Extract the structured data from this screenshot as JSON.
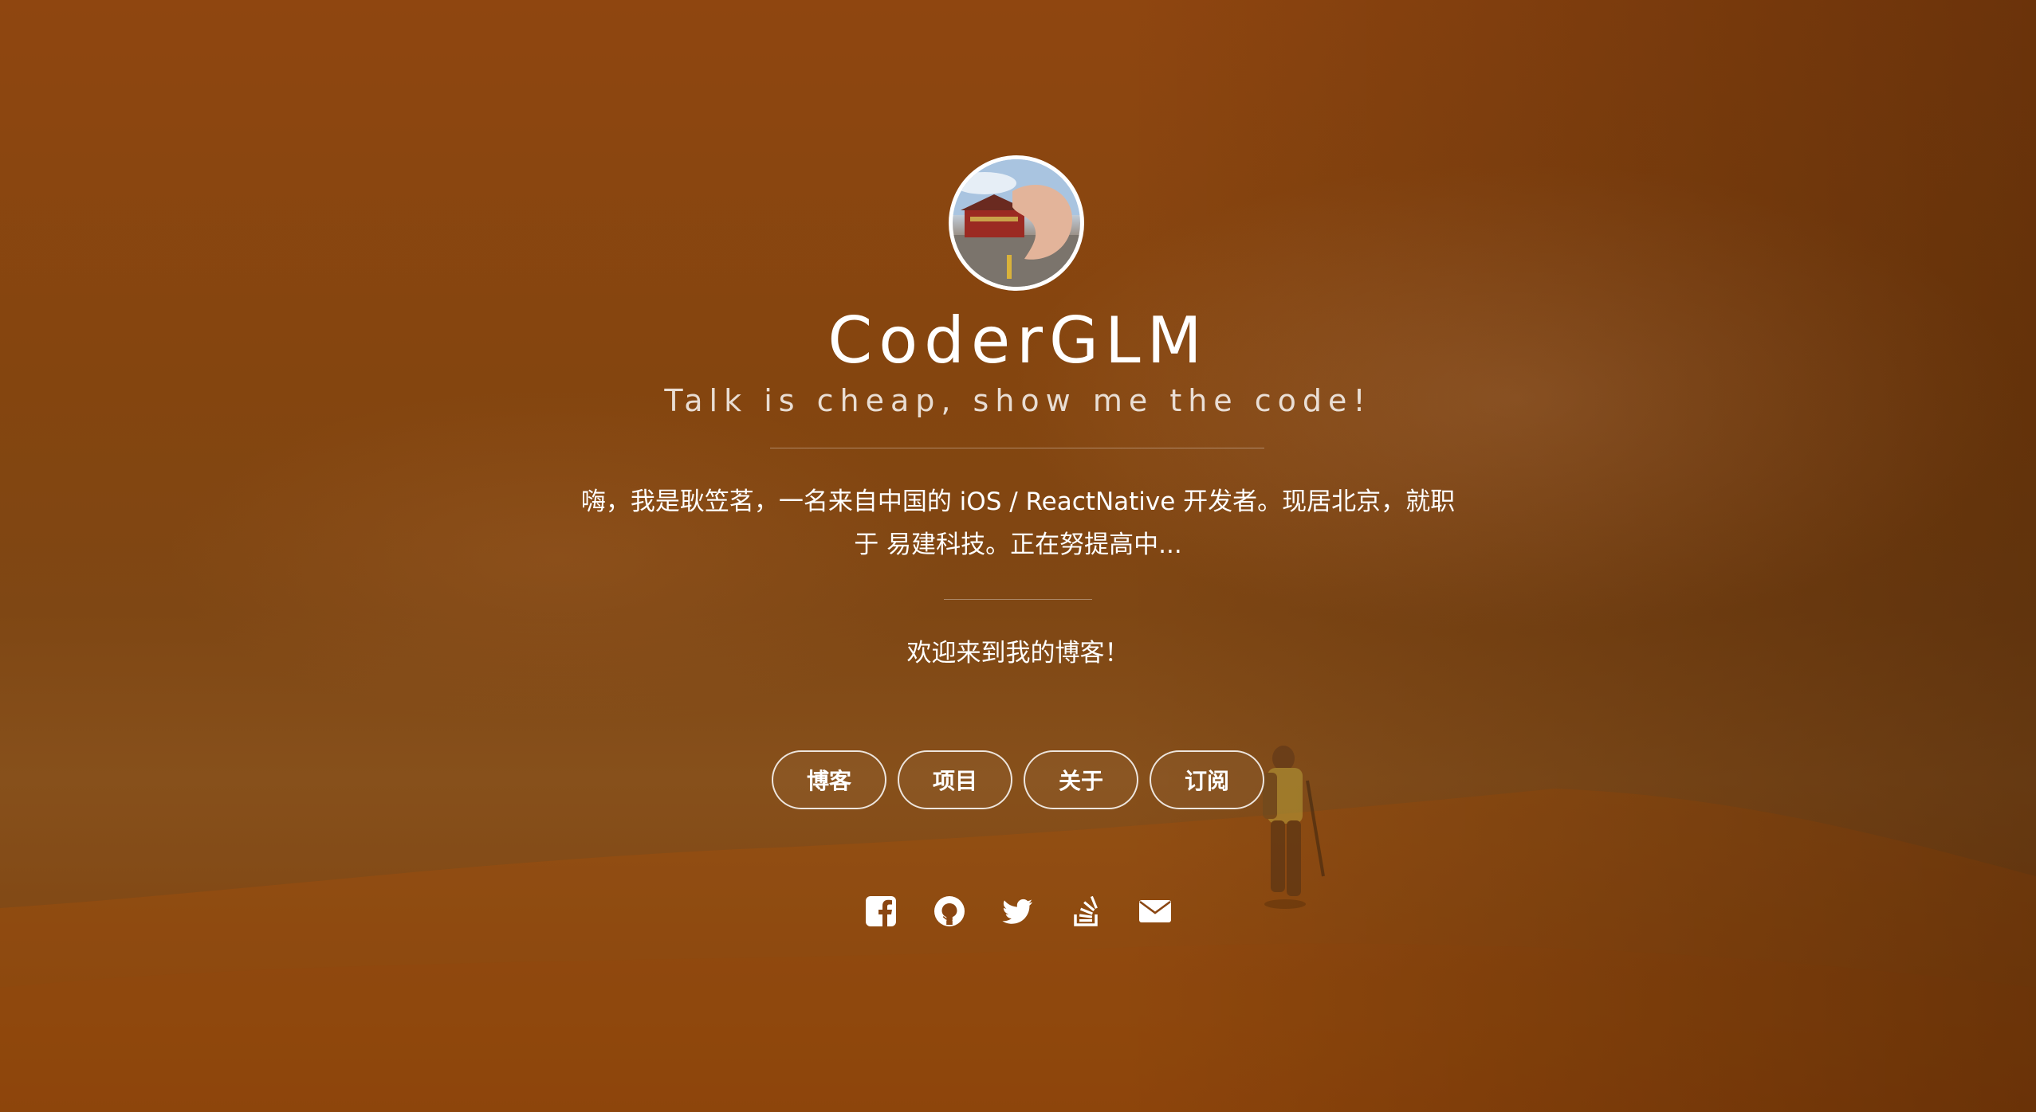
{
  "profile": {
    "name": "CoderGLM",
    "tagline": "Talk is cheap, show me the code!",
    "intro": "嗨，我是耿笠茗，一名来自中国的 iOS / ReactNative 开发者。现居北京，就职于 易建科技。正在努提高中...",
    "welcome": "欢迎来到我的博客！"
  },
  "nav": {
    "items": [
      {
        "label": "博客"
      },
      {
        "label": "项目"
      },
      {
        "label": "关于"
      },
      {
        "label": "订阅"
      }
    ]
  },
  "social": {
    "icons": [
      "facebook-icon",
      "github-icon",
      "twitter-icon",
      "stackoverflow-icon",
      "email-icon"
    ]
  },
  "colors": {
    "background": "#8a4612",
    "text": "#ffffff"
  }
}
